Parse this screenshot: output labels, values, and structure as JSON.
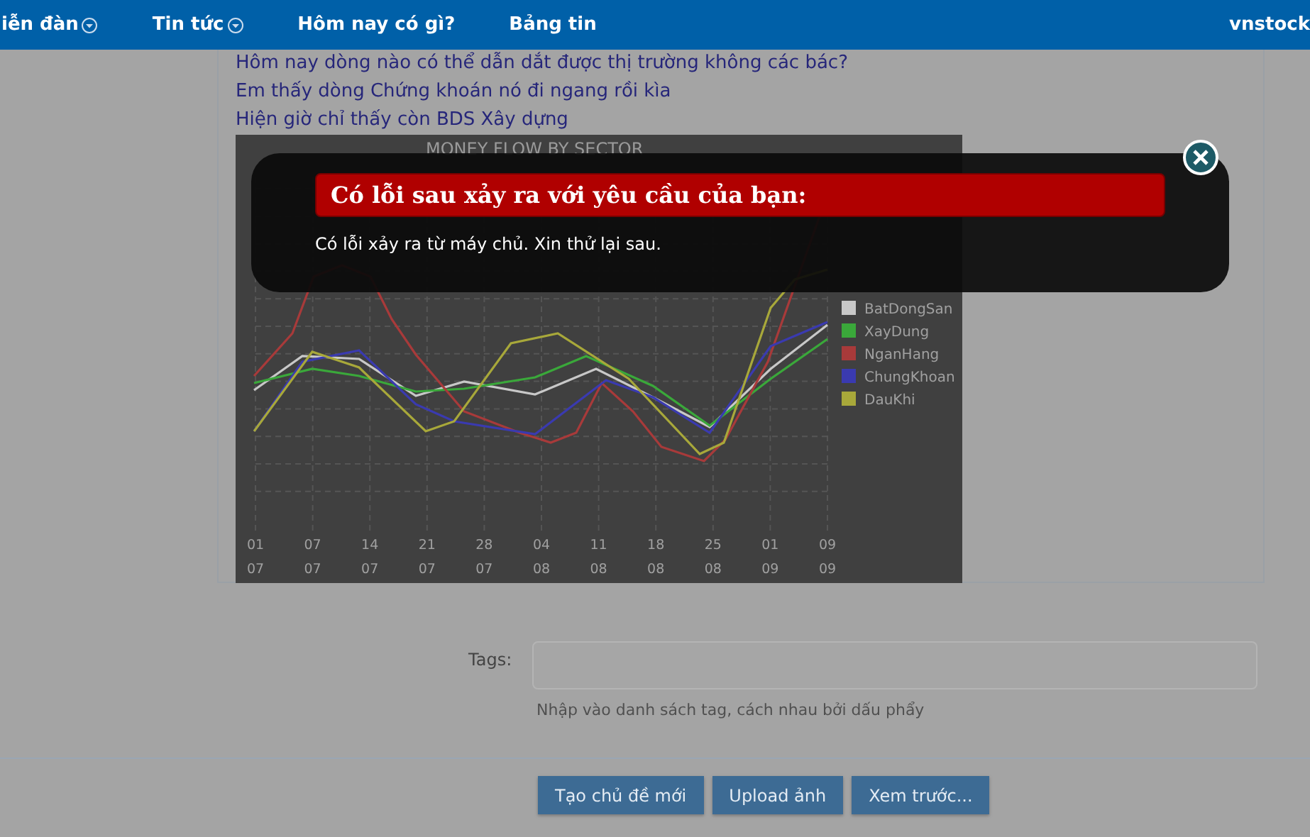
{
  "navbar": {
    "items": [
      {
        "label": "iễn đàn",
        "has_menu": true
      },
      {
        "label": "Tin tức",
        "has_menu": true
      },
      {
        "label": "Hôm nay có gì?",
        "has_menu": false
      },
      {
        "label": "Bảng tin",
        "has_menu": false
      }
    ],
    "user": "vnstock"
  },
  "post": {
    "lines": [
      "Hôm nay dòng nào có thể dẫn dắt được thị trường không các bác?",
      "Em thấy dòng Chứng khoán nó đi ngang rồi kìa",
      "Hiện giờ chỉ thấy còn BDS Xây dựng"
    ],
    "chart": {
      "title": "MONEY FLOW BY SECTOR",
      "x_labels": [
        [
          "01",
          "07"
        ],
        [
          "07",
          "07"
        ],
        [
          "14",
          "07"
        ],
        [
          "21",
          "07"
        ],
        [
          "28",
          "07"
        ],
        [
          "04",
          "08"
        ],
        [
          "11",
          "08"
        ],
        [
          "18",
          "08"
        ],
        [
          "25",
          "08"
        ],
        [
          "01",
          "09"
        ],
        [
          "09",
          "09"
        ]
      ],
      "legend": [
        {
          "name": "BatDongSan",
          "color": "#c8c8c8"
        },
        {
          "name": "XayDung",
          "color": "#3aa83a"
        },
        {
          "name": "NganHang",
          "color": "#a83a3a"
        },
        {
          "name": "ChungKhoan",
          "color": "#3a3ab0"
        },
        {
          "name": "DauKhi",
          "color": "#a8a83a"
        }
      ]
    }
  },
  "tags": {
    "label": "Tags:",
    "hint": "Nhập vào danh sách tag, cách nhau bởi dấu phẩy"
  },
  "buttons": [
    "Tạo chủ đề mới",
    "Upload ảnh",
    "Xem trước..."
  ],
  "modal": {
    "title": "Có lỗi sau xảy ra với yêu cầu của bạn:",
    "message": "Có lỗi xảy ra từ máy chủ. Xin thử lại sau."
  }
}
